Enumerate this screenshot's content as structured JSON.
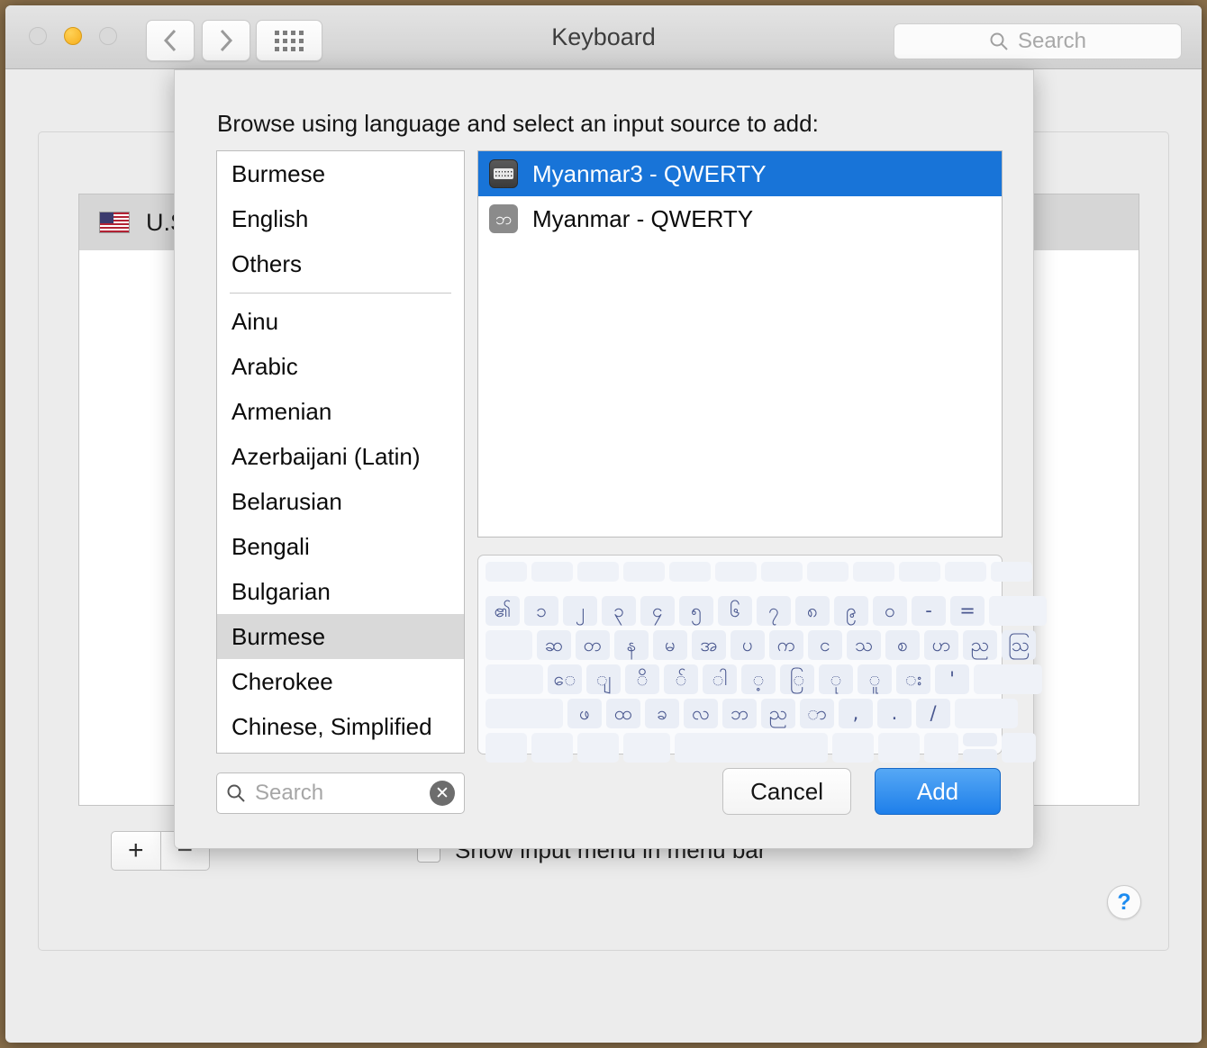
{
  "window": {
    "title": "Keyboard",
    "traffic_lights": [
      "close",
      "minimize",
      "zoom"
    ],
    "nav": {
      "back": "‹",
      "forward": "›",
      "show_all": "grid-icon"
    },
    "search": {
      "placeholder": "Search",
      "value": ""
    }
  },
  "prefs": {
    "input_sources": [
      {
        "label": "U.S.",
        "icon": "us-flag-icon",
        "selected": true
      }
    ],
    "add_button": "+",
    "remove_button": "−",
    "show_input_menu": {
      "label": "Show input menu in menu bar",
      "checked": false
    },
    "help_button": "?"
  },
  "sheet": {
    "title": "Browse using language and select an input source to add:",
    "languages_top": [
      "Burmese",
      "English",
      "Others"
    ],
    "languages": [
      "Ainu",
      "Arabic",
      "Armenian",
      "Azerbaijani (Latin)",
      "Belarusian",
      "Bengali",
      "Bulgarian",
      "Burmese",
      "Cherokee",
      "Chinese, Simplified"
    ],
    "selected_language": "Burmese",
    "input_sources": [
      {
        "label": "Myanmar3 - QWERTY",
        "icon": "keyboard-icon",
        "selected": true
      },
      {
        "label": "Myanmar - QWERTY",
        "icon": "burmese-glyph-icon",
        "glyph": "ဘ",
        "selected": false
      }
    ],
    "search": {
      "placeholder": "Search",
      "value": "",
      "clear": "✕"
    },
    "cancel_label": "Cancel",
    "add_label": "Add",
    "keyboard_preview": {
      "rows": [
        {
          "keys": [
            "",
            "",
            "",
            "",
            "",
            "",
            "",
            "",
            "",
            "",
            "",
            "",
            "",
            ""
          ],
          "type": "function"
        },
        {
          "keys": [
            "၏",
            "၁",
            "၂",
            "၃",
            "၄",
            "၅",
            "၆",
            "၇",
            "၈",
            "၉",
            "၀",
            "-",
            "=",
            ""
          ]
        },
        {
          "keys": [
            "",
            "ဆ",
            "တ",
            "န",
            "မ",
            "အ",
            "ပ",
            "က",
            "င",
            "သ",
            "စ",
            "ဟ",
            "ည",
            "ဩ"
          ]
        },
        {
          "keys": [
            "",
            "ေ",
            "ျ",
            "ိ",
            "်",
            "ါ",
            "့",
            "ြ",
            "ု",
            "ူ",
            "း",
            "'"
          ]
        },
        {
          "keys": [
            "",
            "ဖ",
            "ထ",
            "ခ",
            "လ",
            "ဘ",
            "ည",
            "ာ",
            ",",
            ".",
            "/"
          ]
        },
        {
          "keys": [
            "",
            "",
            "",
            "",
            "",
            "",
            "",
            "",
            ""
          ],
          "type": "modifier"
        }
      ]
    }
  },
  "colors": {
    "accent_blue": "#1874d8",
    "button_blue": "#1e7fea",
    "key_text": "#49578f",
    "key_bg": "#eaeef6",
    "sheet_bg": "#eeeeee",
    "selection_gray": "#d9d9d9"
  }
}
